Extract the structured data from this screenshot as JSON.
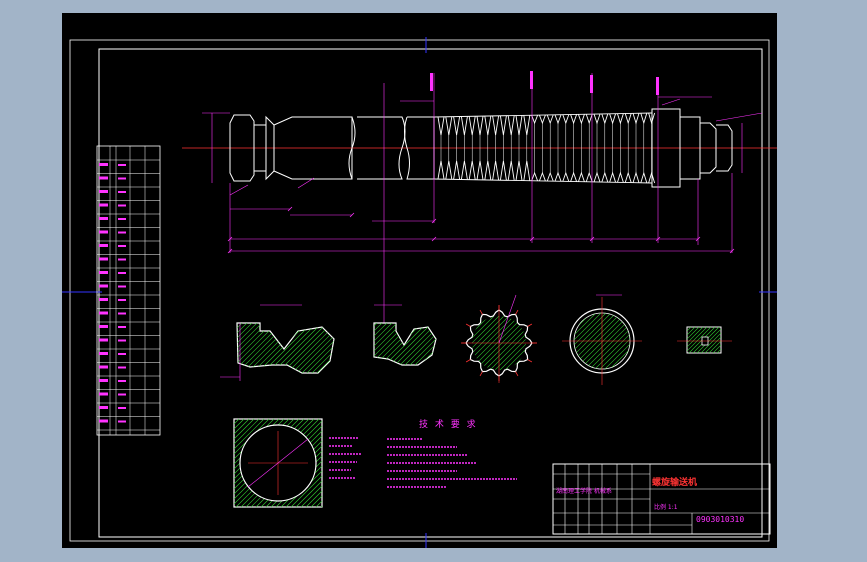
{
  "colors": {
    "background": "#a2b4c8",
    "paper": "#000000",
    "outline": "#ffffff",
    "dimension": "#ff33ff",
    "centerline": "#ff3333",
    "hatch": "#33cc33",
    "frame": "#3333ff"
  },
  "drawing": {
    "title": "螺旋输送机",
    "drawing_number": "0903010310",
    "tech_requirements_heading": "技 术 要 求",
    "school_line": "湖南理工学院 机械系",
    "scale_line": "比例 1:1"
  }
}
